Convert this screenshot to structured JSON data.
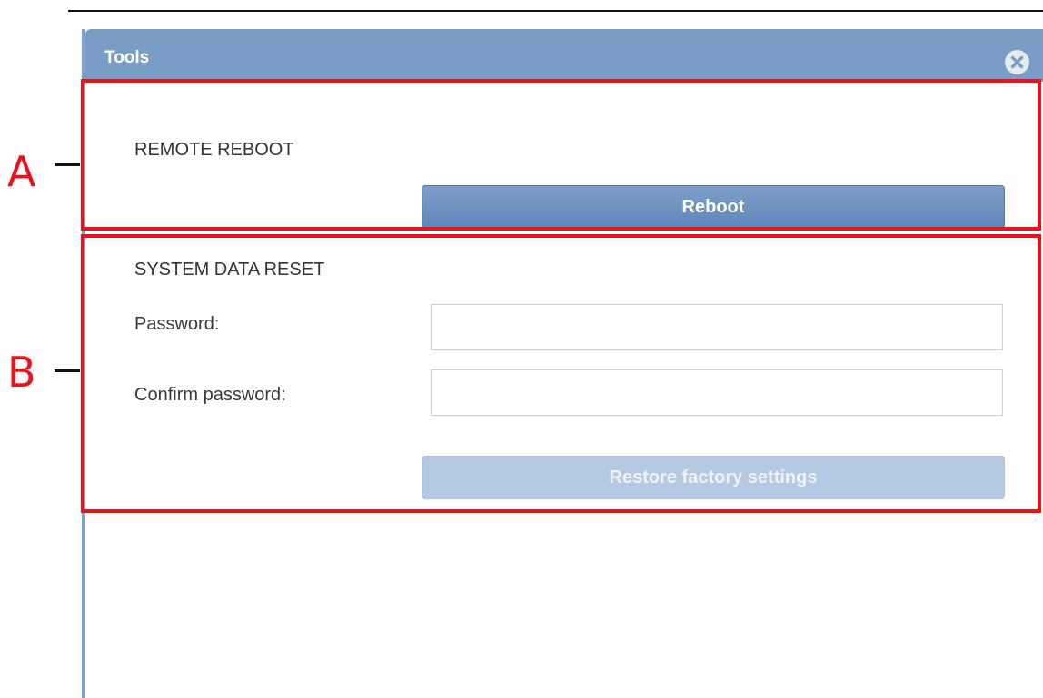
{
  "dialog": {
    "title": "Tools",
    "close_icon": "close-circle-icon"
  },
  "remote_reboot": {
    "heading": "REMOTE REBOOT",
    "reboot_label": "Reboot"
  },
  "system_data_reset": {
    "heading": "SYSTEM DATA RESET",
    "password_label": "Password:",
    "password_value": "",
    "confirm_label": "Confirm password:",
    "confirm_value": "",
    "restore_label": "Restore factory settings",
    "restore_enabled": false
  },
  "callouts": {
    "a_letter": "A",
    "b_letter": "B"
  },
  "colors": {
    "titlebar": "#7a9dc5",
    "primary_button": "#6a90bf",
    "disabled_button": "#b4c9e2",
    "callout": "#e8141c"
  }
}
